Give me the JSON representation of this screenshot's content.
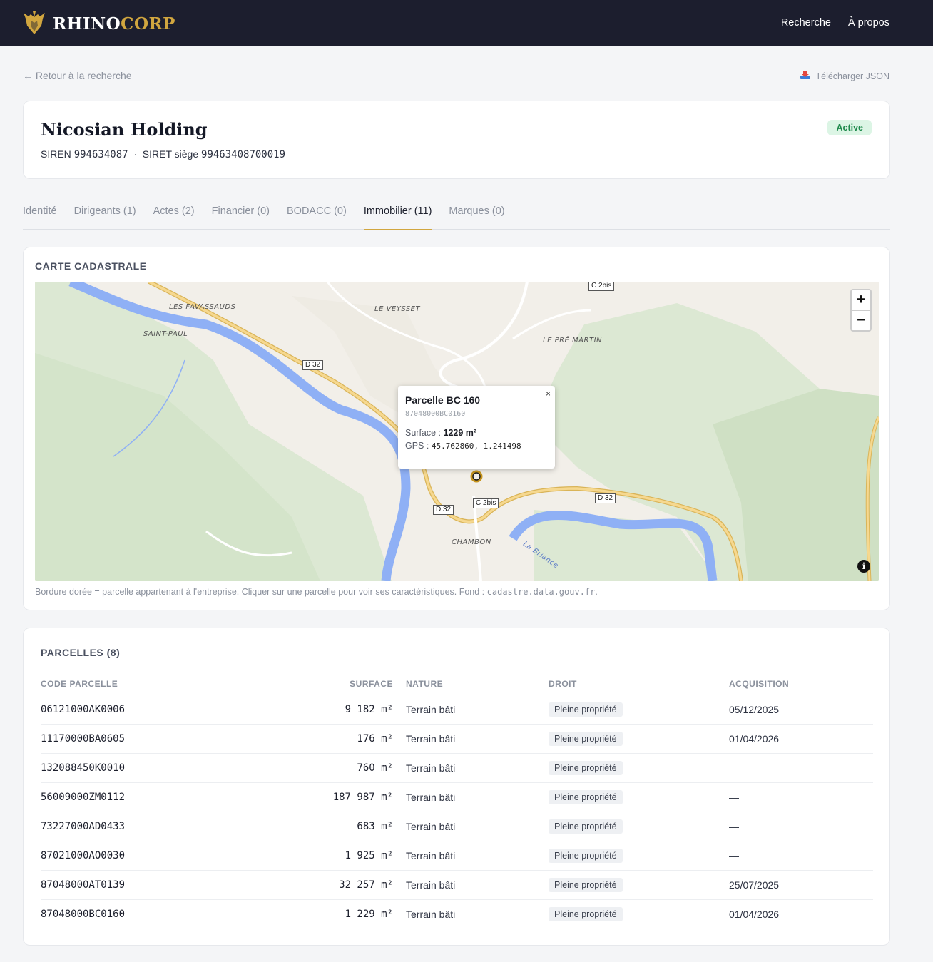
{
  "brand": {
    "part1": "RHINO",
    "part2": "CORP",
    "color_gold": "#d1a63f",
    "logo_icon": "rhino-head-icon"
  },
  "nav": {
    "search": "Recherche",
    "about": "À propos"
  },
  "back_link": "← Retour à la recherche",
  "download": {
    "label": "Télécharger JSON",
    "icon": "download-icon"
  },
  "company": {
    "name": "Nicosian Holding",
    "siren_label": "SIREN",
    "siren": "994634087",
    "separator": "·",
    "siret_label": "SIRET siège",
    "siret": "99463408700019",
    "status": "Active"
  },
  "tabs": [
    {
      "label": "Identité"
    },
    {
      "label": "Dirigeants (1)"
    },
    {
      "label": "Actes (2)"
    },
    {
      "label": "Financier (0)"
    },
    {
      "label": "BODACC (0)"
    },
    {
      "label": "Immobilier (11)",
      "active": true
    },
    {
      "label": "Marques (0)"
    }
  ],
  "map_section": {
    "title": "CARTE CADASTRALE",
    "zoom_in": "+",
    "zoom_out": "−",
    "info": "i",
    "places": [
      "LES FAVASSAUDS",
      "SAINT-PAUL",
      "LE VEYSSET",
      "LE PRÉ MARTIN",
      "CHAMBON"
    ],
    "roads": [
      "C 2bis",
      "D 32",
      "D 32",
      "C 2bis",
      "D 32"
    ],
    "river": "La Briance",
    "popup": {
      "title": "Parcelle BC 160",
      "code": "87048000BC0160",
      "surface_label": "Surface :",
      "surface": "1229 m²",
      "gps_label": "GPS :",
      "gps": "45.762860, 1.241498",
      "close": "×"
    },
    "note_text": "Bordure dorée = parcelle appartenant à l'entreprise. Cliquer sur une parcelle pour voir ses caractéristiques. Fond :",
    "note_source": "cadastre.data.gouv.fr",
    "note_end": "."
  },
  "parcels": {
    "title": "PARCELLES (8)",
    "columns": {
      "code": "CODE PARCELLE",
      "surface": "SURFACE",
      "nature": "NATURE",
      "droit": "DROIT",
      "acquisition": "ACQUISITION"
    },
    "rows": [
      {
        "code": "06121000AK0006",
        "surface": "9 182 m²",
        "nature": "Terrain bâti",
        "droit": "Pleine propriété",
        "acquisition": "05/12/2025"
      },
      {
        "code": "11170000BA0605",
        "surface": "176 m²",
        "nature": "Terrain bâti",
        "droit": "Pleine propriété",
        "acquisition": "01/04/2026"
      },
      {
        "code": "132088450K0010",
        "surface": "760 m²",
        "nature": "Terrain bâti",
        "droit": "Pleine propriété",
        "acquisition": "—"
      },
      {
        "code": "56009000ZM0112",
        "surface": "187 987 m²",
        "nature": "Terrain bâti",
        "droit": "Pleine propriété",
        "acquisition": "—"
      },
      {
        "code": "73227000AD0433",
        "surface": "683 m²",
        "nature": "Terrain bâti",
        "droit": "Pleine propriété",
        "acquisition": "—"
      },
      {
        "code": "87021000AO0030",
        "surface": "1 925 m²",
        "nature": "Terrain bâti",
        "droit": "Pleine propriété",
        "acquisition": "—"
      },
      {
        "code": "87048000AT0139",
        "surface": "32 257 m²",
        "nature": "Terrain bâti",
        "droit": "Pleine propriété",
        "acquisition": "25/07/2025"
      },
      {
        "code": "87048000BC0160",
        "surface": "1 229 m²",
        "nature": "Terrain bâti",
        "droit": "Pleine propriété",
        "acquisition": "01/04/2026"
      }
    ]
  }
}
